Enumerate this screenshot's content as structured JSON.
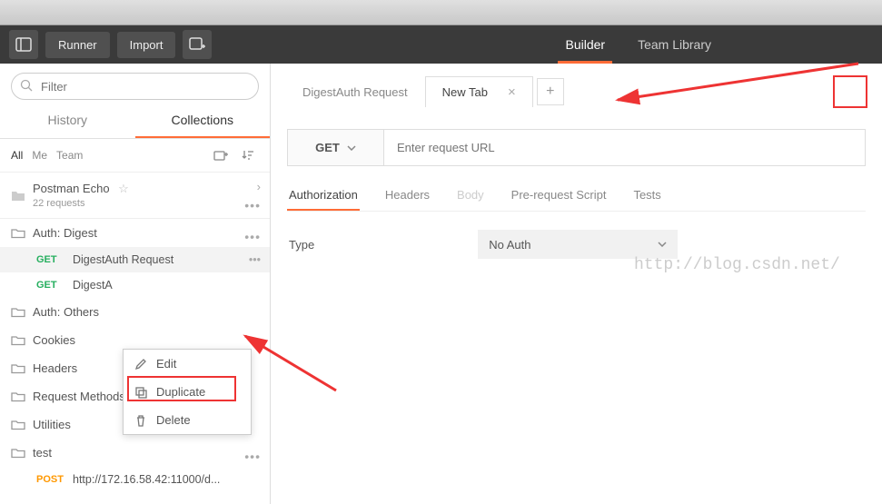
{
  "toolbar": {
    "runner": "Runner",
    "import": "Import"
  },
  "nav": {
    "builder": "Builder",
    "team_library": "Team Library"
  },
  "search": {
    "placeholder": "Filter"
  },
  "side_tabs": {
    "history": "History",
    "collections": "Collections"
  },
  "scopes": {
    "all": "All",
    "me": "Me",
    "team": "Team"
  },
  "collections": {
    "top": {
      "name": "Postman Echo",
      "subtitle": "22 requests"
    },
    "folders": [
      {
        "name": "Auth: Digest"
      },
      {
        "name": "Auth: Others"
      },
      {
        "name": "Cookies"
      },
      {
        "name": "Headers"
      },
      {
        "name": "Request Methods"
      },
      {
        "name": "Utilities"
      },
      {
        "name": "test"
      }
    ],
    "digest_requests": [
      {
        "method": "GET",
        "name": "DigestAuth Request"
      },
      {
        "method": "GET",
        "name": "DigestA"
      }
    ],
    "test_request": {
      "method": "POST",
      "name": "http://172.16.58.42:11000/d..."
    }
  },
  "context_menu": {
    "edit": "Edit",
    "duplicate": "Duplicate",
    "delete": "Delete"
  },
  "tabs": [
    {
      "label": "DigestAuth Request",
      "active": false
    },
    {
      "label": "New Tab",
      "active": true
    }
  ],
  "request": {
    "method": "GET",
    "url_placeholder": "Enter request URL"
  },
  "sub_tabs": {
    "authorization": "Authorization",
    "headers": "Headers",
    "body": "Body",
    "prerequest": "Pre-request Script",
    "tests": "Tests"
  },
  "auth": {
    "type_label": "Type",
    "selected": "No Auth"
  },
  "watermark": "http://blog.csdn.net/"
}
